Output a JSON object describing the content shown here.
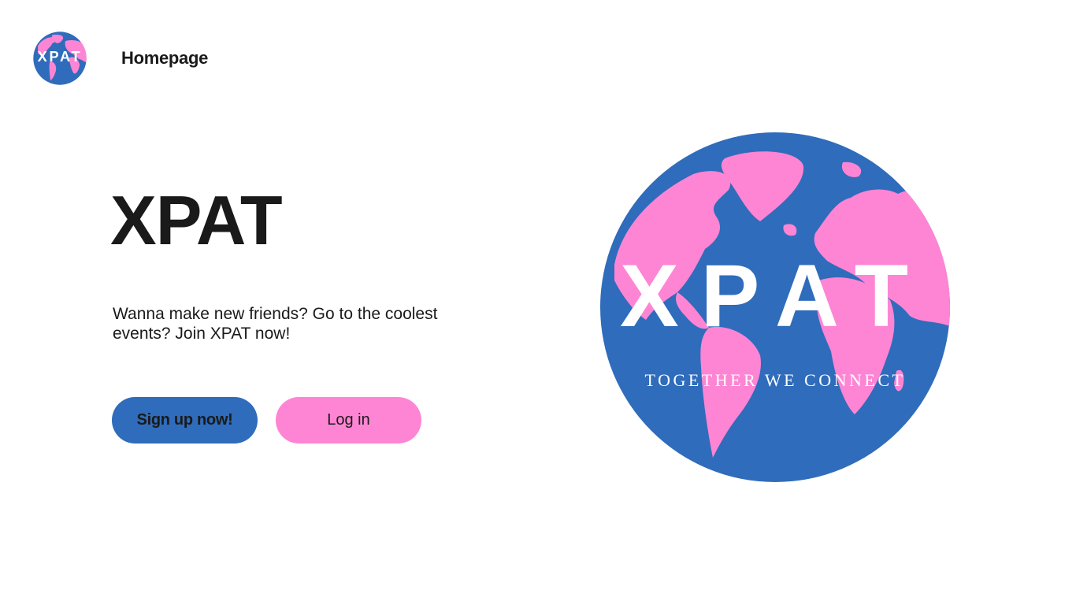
{
  "header": {
    "logo_alt": "XPAT logo",
    "nav_label": "Homepage"
  },
  "hero": {
    "title": "XPAT",
    "tagline": "Wanna make new friends? Go to the coolest events? Join XPAT now!",
    "signup_label": "Sign up now!",
    "login_label": "Log in"
  },
  "logo": {
    "wordmark": "XPAT",
    "slogan": "TOGETHER WE CONNECT",
    "ocean_color": "#2f6cbb",
    "land_color": "#fe85d4",
    "text_color": "#ffffff"
  },
  "icons": {
    "small_logo": "globe-logo-icon",
    "big_logo": "globe-logo-icon"
  },
  "colors": {
    "primary": "#2f6cbb",
    "secondary": "#fe85d4",
    "text": "#1a1a1a",
    "background": "#ffffff"
  }
}
